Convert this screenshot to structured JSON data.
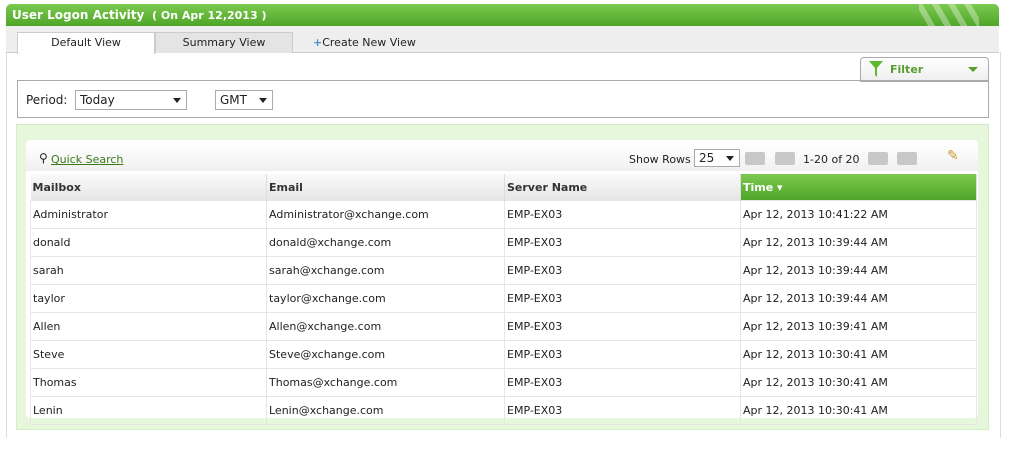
{
  "header": {
    "title": "User Logon Activity",
    "date": "( On Apr 12,2013 )"
  },
  "tabs": [
    {
      "label": "Default View"
    },
    {
      "label": "Summary View"
    }
  ],
  "create_view": "Create New View",
  "filter": {
    "label": "Filter"
  },
  "period": {
    "label": "Period:",
    "value": "Today",
    "timezone": "GMT"
  },
  "toolbar": {
    "quick_search": "Quick Search",
    "show_rows_label": "Show Rows",
    "show_rows_value": "25",
    "page_info": "1-20 of 20"
  },
  "table": {
    "columns": [
      "Mailbox",
      "Email",
      "Server Name",
      "Time"
    ],
    "sort_column": "Time",
    "rows": [
      [
        "Administrator",
        "Administrator@xchange.com",
        "EMP-EX03",
        "Apr 12, 2013 10:41:22 AM"
      ],
      [
        "donald",
        "donald@xchange.com",
        "EMP-EX03",
        "Apr 12, 2013 10:39:44 AM"
      ],
      [
        "sarah",
        "sarah@xchange.com",
        "EMP-EX03",
        "Apr 12, 2013 10:39:44 AM"
      ],
      [
        "taylor",
        "taylor@xchange.com",
        "EMP-EX03",
        "Apr 12, 2013 10:39:44 AM"
      ],
      [
        "Allen",
        "Allen@xchange.com",
        "EMP-EX03",
        "Apr 12, 2013 10:39:41 AM"
      ],
      [
        "Steve",
        "Steve@xchange.com",
        "EMP-EX03",
        "Apr 12, 2013 10:30:41 AM"
      ],
      [
        "Thomas",
        "Thomas@xchange.com",
        "EMP-EX03",
        "Apr 12, 2013 10:30:41 AM"
      ],
      [
        "Lenin",
        "Lenin@xchange.com",
        "EMP-EX03",
        "Apr 12, 2013 10:30:41 AM"
      ]
    ]
  },
  "colors": {
    "accent": "#4ea629",
    "link": "#3a7a1a"
  }
}
